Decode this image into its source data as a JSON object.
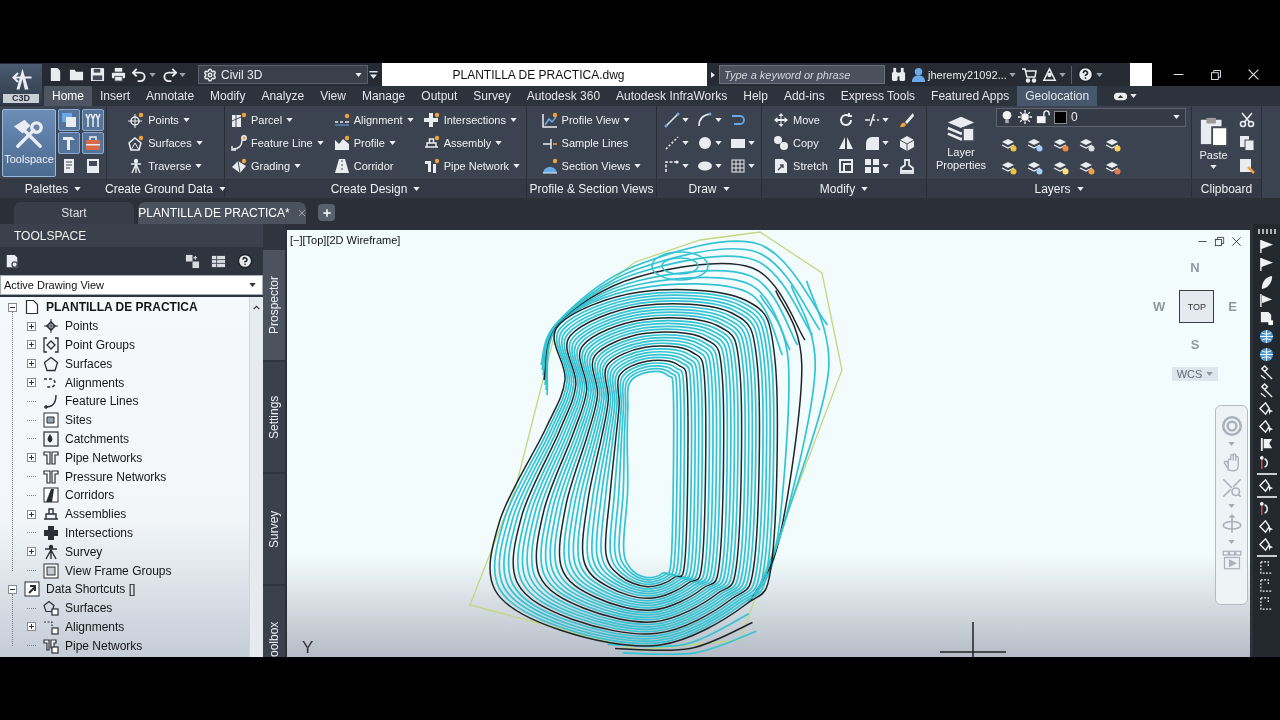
{
  "app_button": {
    "label": "C3D"
  },
  "quick_access": [
    {
      "kind": "new",
      "menu": false
    },
    {
      "kind": "open",
      "menu": false
    },
    {
      "kind": "save",
      "menu": false
    },
    {
      "kind": "print",
      "menu": false
    },
    {
      "kind": "undo",
      "menu": true
    },
    {
      "kind": "redo",
      "menu": true
    }
  ],
  "workspace": {
    "value": "Civil 3D"
  },
  "title": "PLANTILLA DE PRACTICA.dwg",
  "search": {
    "placeholder": "Type a keyword or phrase"
  },
  "user": {
    "name": "jheremy21092..."
  },
  "ribbon_tabs": [
    {
      "label": "Home",
      "selected": true,
      "contextual": false
    },
    {
      "label": "Insert",
      "selected": false,
      "contextual": false
    },
    {
      "label": "Annotate",
      "selected": false,
      "contextual": false
    },
    {
      "label": "Modify",
      "selected": false,
      "contextual": false
    },
    {
      "label": "Analyze",
      "selected": false,
      "contextual": false
    },
    {
      "label": "View",
      "selected": false,
      "contextual": false
    },
    {
      "label": "Manage",
      "selected": false,
      "contextual": false
    },
    {
      "label": "Output",
      "selected": false,
      "contextual": false
    },
    {
      "label": "Survey",
      "selected": false,
      "contextual": false
    },
    {
      "label": "Autodesk 360",
      "selected": false,
      "contextual": false
    },
    {
      "label": "Autodesk InfraWorks",
      "selected": false,
      "contextual": false
    },
    {
      "label": "Help",
      "selected": false,
      "contextual": false
    },
    {
      "label": "Add-ins",
      "selected": false,
      "contextual": false
    },
    {
      "label": "Express Tools",
      "selected": false,
      "contextual": false
    },
    {
      "label": "Featured Apps",
      "selected": false,
      "contextual": false
    },
    {
      "label": "Geolocation",
      "selected": false,
      "contextual": true
    }
  ],
  "panels": [
    {
      "title": "Palettes",
      "menu": true,
      "big": {
        "kind": "toolspace",
        "label": "Toolspace",
        "active": true,
        "menu": false
      },
      "columns": [
        [
          {
            "kind": "stack",
            "menu": false,
            "active": true
          },
          {
            "kind": "hammer",
            "menu": false,
            "active": true
          },
          {
            "kind": "document",
            "menu": false,
            "active": false
          }
        ],
        [
          {
            "kind": "branch",
            "menu": false,
            "active": true
          },
          {
            "kind": "toolbox",
            "menu": false,
            "active": true
          },
          {
            "kind": "form",
            "menu": false,
            "active": false
          }
        ]
      ]
    },
    {
      "title": "Create Ground Data",
      "menu": true,
      "columns": [
        [
          {
            "kind": "points",
            "label": "Points",
            "menu": true
          },
          {
            "kind": "surfaces",
            "label": "Surfaces",
            "menu": true
          },
          {
            "kind": "traverse",
            "label": "Traverse",
            "menu": true
          }
        ]
      ]
    },
    {
      "title": "Create Design",
      "menu": true,
      "columns": [
        [
          {
            "kind": "parcel",
            "label": "Parcel",
            "menu": true
          },
          {
            "kind": "feature-line",
            "label": "Feature Line",
            "menu": true
          },
          {
            "kind": "grading",
            "label": "Grading",
            "menu": true
          }
        ],
        [
          {
            "kind": "alignment",
            "label": "Alignment",
            "menu": true
          },
          {
            "kind": "profile",
            "label": "Profile",
            "menu": true
          },
          {
            "kind": "corridor",
            "label": "Corridor",
            "menu": false
          }
        ],
        [
          {
            "kind": "intersections",
            "label": "Intersections",
            "menu": true
          },
          {
            "kind": "assembly",
            "label": "Assembly",
            "menu": true
          },
          {
            "kind": "pipe-network",
            "label": "Pipe Network",
            "menu": true
          }
        ]
      ]
    },
    {
      "title": "Profile & Section Views",
      "menu": false,
      "columns": [
        [
          {
            "kind": "profile-view",
            "label": "Profile View",
            "menu": true
          },
          {
            "kind": "sample-lines",
            "label": "Sample Lines",
            "menu": false
          },
          {
            "kind": "section-views",
            "label": "Section Views",
            "menu": true
          }
        ]
      ]
    },
    {
      "title": "Draw",
      "menu": true,
      "columns": [
        [
          {
            "kind": "line",
            "menu": true
          },
          {
            "kind": "xline",
            "menu": true
          },
          {
            "kind": "corner",
            "menu": true
          }
        ],
        [
          {
            "kind": "polyline",
            "menu": true
          },
          {
            "kind": "circle",
            "menu": true
          },
          {
            "kind": "ellipse",
            "menu": true
          }
        ],
        [
          {
            "kind": "spline",
            "menu": false
          },
          {
            "kind": "rectangle",
            "menu": true
          },
          {
            "kind": "hatch",
            "menu": true
          }
        ]
      ]
    },
    {
      "title": "Modify",
      "menu": true,
      "columns": [
        [
          {
            "kind": "move",
            "label": "Move",
            "menu": false
          },
          {
            "kind": "copy",
            "label": "Copy",
            "menu": false
          },
          {
            "kind": "stretch",
            "label": "Stretch",
            "menu": false
          }
        ],
        [
          {
            "kind": "rotate",
            "menu": false
          },
          {
            "kind": "mirror",
            "menu": false
          },
          {
            "kind": "offset",
            "menu": false
          }
        ],
        [
          {
            "kind": "trim",
            "menu": true
          },
          {
            "kind": "fillet",
            "menu": true
          },
          {
            "kind": "array",
            "menu": true
          }
        ],
        [
          {
            "kind": "brush",
            "menu": false
          },
          {
            "kind": "cube",
            "menu": false
          },
          {
            "kind": "stamp",
            "menu": false
          }
        ]
      ]
    },
    {
      "title": "Layers",
      "menu": true,
      "big": {
        "kind": "layer-properties",
        "label": "Layer Properties",
        "active": false,
        "menu": false
      },
      "layer": {
        "value": "0"
      },
      "columns": [
        [
          {
            "kind": "layer-off",
            "menu": false
          },
          {
            "kind": "layer-match",
            "menu": false
          }
        ],
        [
          {
            "kind": "layer-isolate",
            "menu": false
          },
          {
            "kind": "layer-change",
            "menu": false
          }
        ],
        [
          {
            "kind": "layer-freeze",
            "menu": false
          },
          {
            "kind": "layer-current",
            "menu": false
          }
        ],
        [
          {
            "kind": "layer-lock",
            "menu": false
          },
          {
            "kind": "layer-unlock",
            "menu": false
          }
        ],
        [
          {
            "kind": "layer-walk",
            "menu": false
          },
          {
            "kind": "layer-merge",
            "menu": false
          }
        ]
      ]
    },
    {
      "title": "Clipboard",
      "menu": false,
      "big": {
        "kind": "paste",
        "label": "Paste",
        "active": false,
        "menu": true
      },
      "columns": [
        [
          {
            "kind": "cut",
            "menu": false
          },
          {
            "kind": "copy-clip",
            "menu": false
          },
          {
            "kind": "paste-special",
            "menu": false
          }
        ]
      ]
    }
  ],
  "doc_tabs": [
    {
      "label": "Start",
      "selected": false,
      "closable": false
    },
    {
      "label": "PLANTILLA DE PRACTICA*",
      "selected": true,
      "closable": true
    }
  ],
  "toolspace": {
    "title": "TOOLSPACE",
    "view": {
      "value": "Active Drawing View"
    },
    "tree": [
      {
        "label": "PLANTILLA DE PRACTICA",
        "kind": "drawing",
        "expandable": true,
        "expanded": true,
        "children": [
          {
            "label": "Points",
            "kind": "points",
            "expandable": true,
            "expanded": false
          },
          {
            "label": "Point Groups",
            "kind": "point-groups",
            "expandable": true,
            "expanded": false
          },
          {
            "label": "Surfaces",
            "kind": "surfaces",
            "expandable": true,
            "expanded": false
          },
          {
            "label": "Alignments",
            "kind": "alignments",
            "expandable": true,
            "expanded": false
          },
          {
            "label": "Feature Lines",
            "kind": "feature-lines",
            "expandable": false
          },
          {
            "label": "Sites",
            "kind": "sites",
            "expandable": false
          },
          {
            "label": "Catchments",
            "kind": "catchments",
            "expandable": false
          },
          {
            "label": "Pipe Networks",
            "kind": "pipe-networks",
            "expandable": true,
            "expanded": false
          },
          {
            "label": "Pressure Networks",
            "kind": "pressure-networks",
            "expandable": false
          },
          {
            "label": "Corridors",
            "kind": "corridors",
            "expandable": false
          },
          {
            "label": "Assemblies",
            "kind": "assemblies",
            "expandable": true,
            "expanded": false
          },
          {
            "label": "Intersections",
            "kind": "intersections",
            "expandable": false
          },
          {
            "label": "Survey",
            "kind": "survey",
            "expandable": true,
            "expanded": false
          },
          {
            "label": "View Frame Groups",
            "kind": "view-frame-groups",
            "expandable": false
          }
        ]
      },
      {
        "label": "Data Shortcuts []",
        "kind": "shortcuts",
        "expandable": true,
        "expanded": true,
        "children": [
          {
            "label": "Surfaces",
            "kind": "shortcut-surfaces",
            "expandable": false
          },
          {
            "label": "Alignments",
            "kind": "shortcut-alignments",
            "expandable": true,
            "expanded": false
          },
          {
            "label": "Pipe Networks",
            "kind": "shortcut-pipe-networks",
            "expandable": false
          }
        ]
      }
    ],
    "side_tabs": [
      {
        "label": "Prospector",
        "selected": true
      },
      {
        "label": "Settings",
        "selected": false
      },
      {
        "label": "Survey",
        "selected": false
      },
      {
        "label": "oolbox",
        "selected": false
      }
    ]
  },
  "viewport": {
    "label": "[−][Top][2D Wireframe]",
    "viewcube": {
      "north": "N",
      "west": "W",
      "top": "TOP",
      "east": "E",
      "south": "S",
      "ucs": "WCS"
    },
    "ucs_axis": "Y"
  }
}
